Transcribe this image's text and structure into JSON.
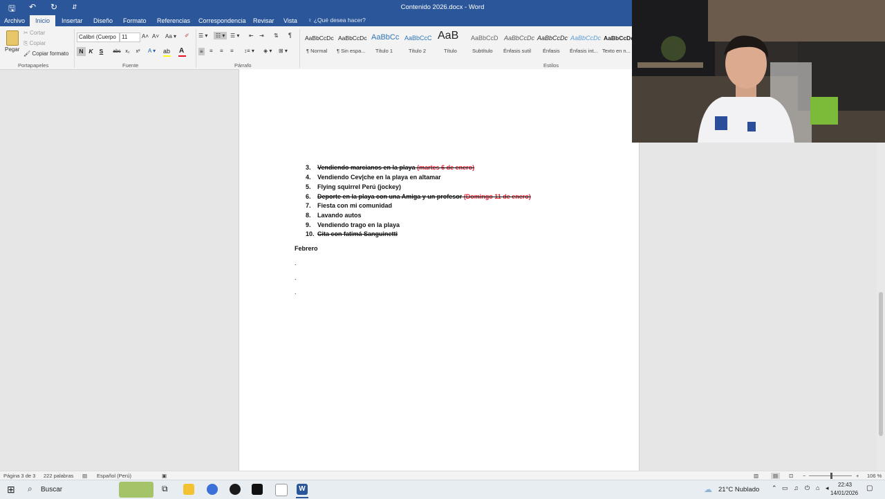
{
  "window": {
    "doc_title": "Contenido 2026.docx - Word"
  },
  "quick_access": {
    "save": "🖫",
    "undo": "↶",
    "redo": "↻",
    "more": "⇵"
  },
  "tabs": [
    "Archivo",
    "Inicio",
    "Insertar",
    "Diseño",
    "Formato",
    "Referencias",
    "Correspondencia",
    "Revisar",
    "Vista"
  ],
  "tell_me": "¿Qué desea hacer?",
  "clipboard": {
    "paste": "Pegar",
    "cut": "Cortar",
    "copy": "Copiar",
    "format_painter": "Copiar formato",
    "group": "Portapapeles"
  },
  "font": {
    "name": "Calibri (Cuerpo",
    "size": "11",
    "group": "Fuente",
    "bold": "N",
    "italic": "K",
    "underline": "S",
    "strike": "abc",
    "sub": "x₂",
    "sup": "x²"
  },
  "paragraph": {
    "group": "Párrafo",
    "pilcrow": "¶"
  },
  "styles": {
    "group": "Estilos",
    "items": [
      {
        "preview": "AaBbCcDc",
        "label": "¶ Normal"
      },
      {
        "preview": "AaBbCcDc",
        "label": "¶ Sin espa..."
      },
      {
        "preview": "AaBbCc",
        "label": "Título 1"
      },
      {
        "preview": "AaBbCcC",
        "label": "Título 2"
      },
      {
        "preview": "AaB",
        "label": "Título"
      },
      {
        "preview": "AaBbCcD",
        "label": "Subtítulo"
      },
      {
        "preview": "AaBbCcDc",
        "label": "Énfasis sutil"
      },
      {
        "preview": "AaBbCcDc",
        "label": "Énfasis"
      },
      {
        "preview": "AaBbCcDc",
        "label": "Énfasis int..."
      },
      {
        "preview": "AaBbCcDc",
        "label": "Texto en n..."
      }
    ]
  },
  "document": {
    "list": [
      {
        "num": "3.",
        "text": "Vendiendo marcianos en la playa",
        "note": "(martes 6 de enero)",
        "done": true
      },
      {
        "num": "4.",
        "text": "Vendiendo Cev|che en la playa en altamar",
        "note": "",
        "done": false
      },
      {
        "num": "5.",
        "text": "Flying squirrel Perú (jockey)",
        "note": "",
        "done": false
      },
      {
        "num": "6.",
        "text": "Deporte en la playa con una Amiga y un profesor",
        "note": "(Domingo 11 de enero)",
        "done": true
      },
      {
        "num": "7.",
        "text": "Fiesta con mi comunidad",
        "note": "",
        "done": false
      },
      {
        "num": "8.",
        "text": "Lavando autos",
        "note": "",
        "done": false
      },
      {
        "num": "9.",
        "text": "Vendiendo trago en la playa",
        "note": "",
        "done": false
      },
      {
        "num": "10.",
        "text": "Cita con fatimá Sanguinetti",
        "note": "",
        "done": true
      }
    ],
    "heading": "Febrero",
    "bullets": [
      ".",
      ".",
      "."
    ]
  },
  "status": {
    "page": "Página 3 de 3",
    "words": "222 palabras",
    "language": "Español (Perú)",
    "zoom": "106 %"
  },
  "taskbar": {
    "search": "Buscar",
    "weather": "21°C  Nublado",
    "time": "22:43",
    "date": "14/01/2026"
  },
  "colors": {
    "word_blue": "#2b579a",
    "red_note": "#e81123"
  }
}
